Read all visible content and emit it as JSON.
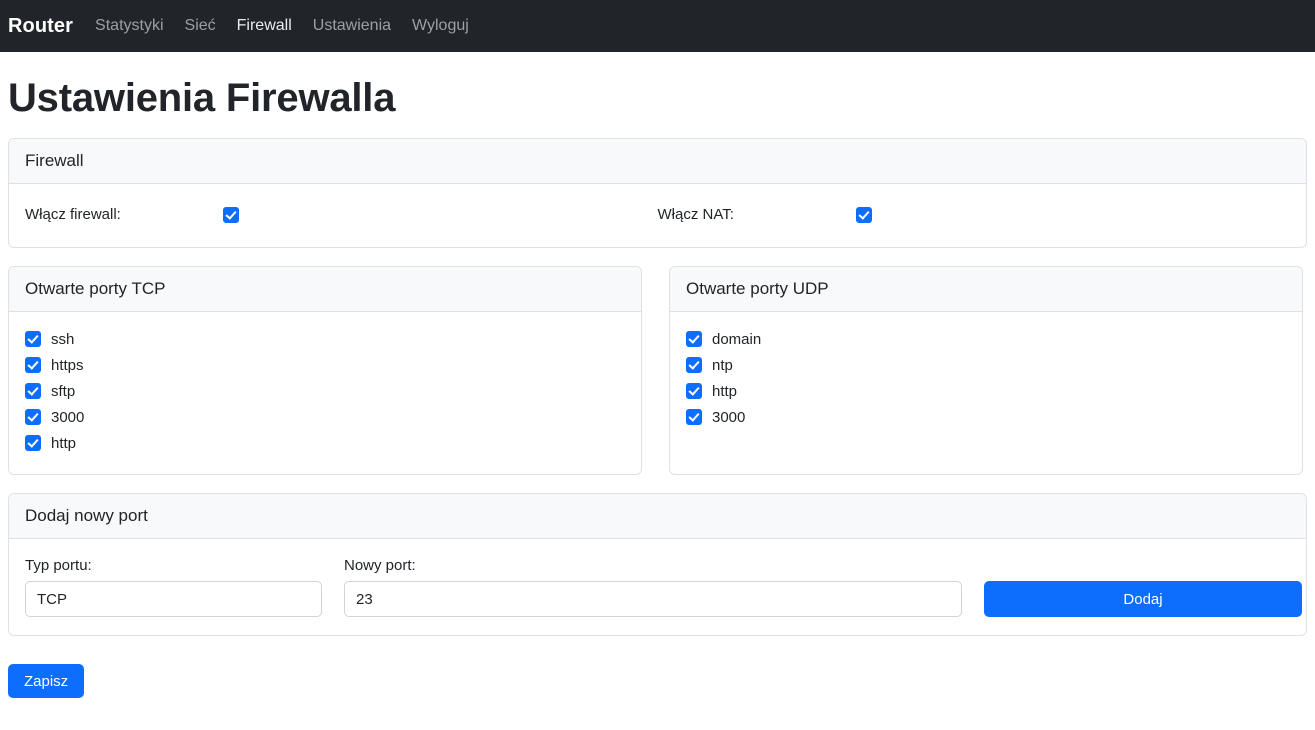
{
  "navbar": {
    "brand": "Router",
    "links": [
      {
        "label": "Statystyki",
        "active": false
      },
      {
        "label": "Sieć",
        "active": false
      },
      {
        "label": "Firewall",
        "active": true
      },
      {
        "label": "Ustawienia",
        "active": false
      },
      {
        "label": "Wyloguj",
        "active": false
      }
    ]
  },
  "page": {
    "title": "Ustawienia Firewalla"
  },
  "firewall_card": {
    "header": "Firewall",
    "toggles": [
      {
        "label": "Włącz firewall:",
        "checked": true
      },
      {
        "label": "Włącz NAT:",
        "checked": true
      }
    ]
  },
  "tcp_card": {
    "header": "Otwarte porty TCP",
    "ports": [
      {
        "label": "ssh",
        "checked": true
      },
      {
        "label": "https",
        "checked": true
      },
      {
        "label": "sftp",
        "checked": true
      },
      {
        "label": "3000",
        "checked": true
      },
      {
        "label": "http",
        "checked": true
      }
    ]
  },
  "udp_card": {
    "header": "Otwarte porty UDP",
    "ports": [
      {
        "label": "domain",
        "checked": true
      },
      {
        "label": "ntp",
        "checked": true
      },
      {
        "label": "http",
        "checked": true
      },
      {
        "label": "3000",
        "checked": true
      }
    ]
  },
  "add_port_card": {
    "header": "Dodaj nowy port",
    "type_label": "Typ portu:",
    "type_value": "TCP",
    "port_label": "Nowy port:",
    "port_value": "23",
    "add_button": "Dodaj"
  },
  "footer": {
    "save_button": "Zapisz"
  },
  "colors": {
    "navbar_bg": "#212529",
    "accent": "#0d6efd",
    "card_header_bg": "#f8f9fa",
    "border": "#dee2e6"
  }
}
